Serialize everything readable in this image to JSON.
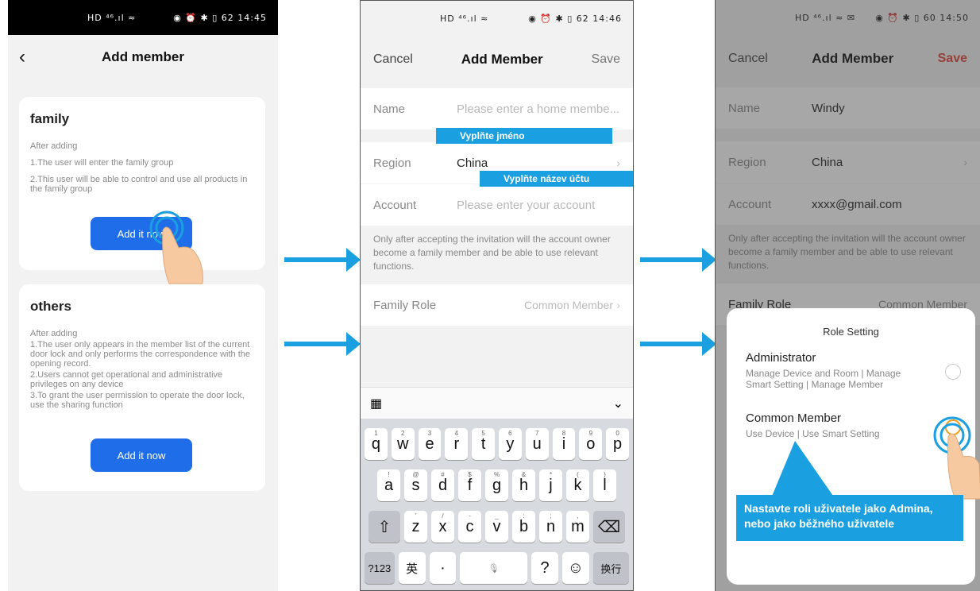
{
  "status": {
    "s1": {
      "signal": "HD ⁴⁶.ıl ≈",
      "icons": "◉ ⏰ ✱ ▯ 62",
      "time": "14:45"
    },
    "s2": {
      "signal": "HD ⁴⁶.ıl ≈",
      "icons": "◉ ⏰ ✱ ▯ 62",
      "time": "14:46"
    },
    "s3": {
      "signal": "HD ⁴⁶.ıl ≈ ✉",
      "icons": "◉ ⏰ ✱ ▯ 60",
      "time": "14:50"
    }
  },
  "screen1": {
    "title": "Add member",
    "back": "‹",
    "family": {
      "heading": "family",
      "lines": [
        "After adding",
        "1.The user will enter the family group",
        "2.This user will be able to control and use all products in the family group"
      ],
      "button": "Add it now"
    },
    "others": {
      "heading": "others",
      "lines": [
        "After adding",
        "1.The user only appears in the member list of the current door lock and only performs the correspondence with the opening record.",
        "2.Users cannot get operational and administrative privileges on any device",
        "3.To grant the user permission to operate the door lock, use the sharing function"
      ],
      "button": "Add it now"
    }
  },
  "screen2": {
    "cancel": "Cancel",
    "title": "Add Member",
    "save": "Save",
    "name_label": "Name",
    "name_placeholder": "Please enter a home membe...",
    "region_label": "Region",
    "region_value": "China",
    "account_label": "Account",
    "account_placeholder": "Please enter your account",
    "note": "Only after accepting the invitation will the account owner become a family member and be able to use relevant functions.",
    "role_label": "Family Role",
    "role_value": "Common Member",
    "callout_name": "Vyplňte jméno",
    "callout_account": "Vyplňte název účtu",
    "keyboard": {
      "row1": [
        "q",
        "w",
        "e",
        "r",
        "t",
        "y",
        "u",
        "i",
        "o",
        "p"
      ],
      "row1_nums": [
        "1",
        "2",
        "3",
        "4",
        "5",
        "6",
        "7",
        "8",
        "9",
        "0"
      ],
      "row2": [
        "a",
        "s",
        "d",
        "f",
        "g",
        "h",
        "j",
        "k",
        "l"
      ],
      "row2_syms": [
        "!",
        "@",
        "#",
        "$",
        "%",
        "&",
        "*",
        "(",
        ")"
      ],
      "row3": [
        "z",
        "x",
        "c",
        "v",
        "b",
        "n",
        "m"
      ],
      "row3_syms": [
        "'",
        "/",
        "-",
        "_",
        ":",
        ";",
        ","
      ],
      "mode": "?123",
      "lang": "英",
      "dot": "·",
      "question": "?",
      "emoji": "☺",
      "enter": "换行"
    }
  },
  "screen3": {
    "cancel": "Cancel",
    "title": "Add Member",
    "save": "Save",
    "name_label": "Name",
    "name_value": "Windy",
    "region_label": "Region",
    "region_value": "China",
    "account_label": "Account",
    "account_value": "xxxx@gmail.com",
    "note": "Only after accepting the invitation will the account owner become a family member and be able to use relevant functions.",
    "role_label": "Family Role",
    "role_value": "Common Member",
    "sheet_title": "Role Setting",
    "admin_title": "Administrator",
    "admin_desc": "Manage Device and Room | Manage Smart Setting | Manage Member",
    "common_title": "Common Member",
    "common_desc": "Use Device | Use Smart Setting",
    "callout": "Nastavte roli uživatele jako Admina, nebo jako běžného uživatele"
  },
  "colors": {
    "accent": "#1aa0e0",
    "primary_button": "#1f6de8",
    "save_active": "#e0443a"
  }
}
